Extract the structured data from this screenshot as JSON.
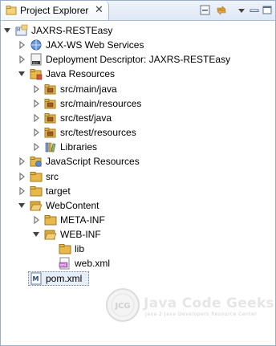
{
  "view": {
    "tab_title": "Project Explorer",
    "close_glyph": "✕",
    "toolbar": [
      "collapse-all-icon",
      "link-with-editor-icon"
    ]
  },
  "tree": [
    {
      "label": "JAXRS-RESTEasy",
      "icon": "project-icon",
      "expanded": true,
      "depth": 0
    },
    {
      "label": "JAX-WS Web Services",
      "icon": "webservices-icon",
      "expanded": false,
      "depth": 1
    },
    {
      "label": "Deployment Descriptor: JAXRS-RESTEasy",
      "icon": "deployment-descriptor-icon",
      "expanded": false,
      "depth": 1
    },
    {
      "label": "Java Resources",
      "icon": "java-resources-icon",
      "expanded": true,
      "depth": 1
    },
    {
      "label": "src/main/java",
      "icon": "source-folder-icon",
      "expanded": false,
      "depth": 2
    },
    {
      "label": "src/main/resources",
      "icon": "source-folder-icon",
      "expanded": false,
      "depth": 2
    },
    {
      "label": "src/test/java",
      "icon": "source-folder-icon",
      "expanded": false,
      "depth": 2
    },
    {
      "label": "src/test/resources",
      "icon": "source-folder-icon",
      "expanded": false,
      "depth": 2
    },
    {
      "label": "Libraries",
      "icon": "libraries-icon",
      "expanded": false,
      "depth": 2
    },
    {
      "label": "JavaScript Resources",
      "icon": "javascript-resources-icon",
      "expanded": false,
      "depth": 1
    },
    {
      "label": "src",
      "icon": "folder-icon",
      "expanded": false,
      "depth": 1
    },
    {
      "label": "target",
      "icon": "folder-icon",
      "expanded": false,
      "depth": 1
    },
    {
      "label": "WebContent",
      "icon": "folder-open-icon",
      "expanded": true,
      "depth": 1
    },
    {
      "label": "META-INF",
      "icon": "folder-icon",
      "expanded": false,
      "depth": 2
    },
    {
      "label": "WEB-INF",
      "icon": "folder-open-icon",
      "expanded": true,
      "depth": 2
    },
    {
      "label": "lib",
      "icon": "folder-icon",
      "expanded": null,
      "depth": 3
    },
    {
      "label": "web.xml",
      "icon": "xml-file-icon",
      "expanded": null,
      "depth": 3
    },
    {
      "label": "pom.xml",
      "icon": "maven-pom-icon",
      "expanded": null,
      "depth": 1,
      "selected": true
    }
  ],
  "branding": {
    "logo_initials": "JCG",
    "title": "Java Code Geeks",
    "tagline": "Java 2 Java Developers Resource Center"
  },
  "colors": {
    "panel_border": "#9ab0c8",
    "folder": "#e8b84a",
    "selection_bg": "#e6eef9"
  }
}
